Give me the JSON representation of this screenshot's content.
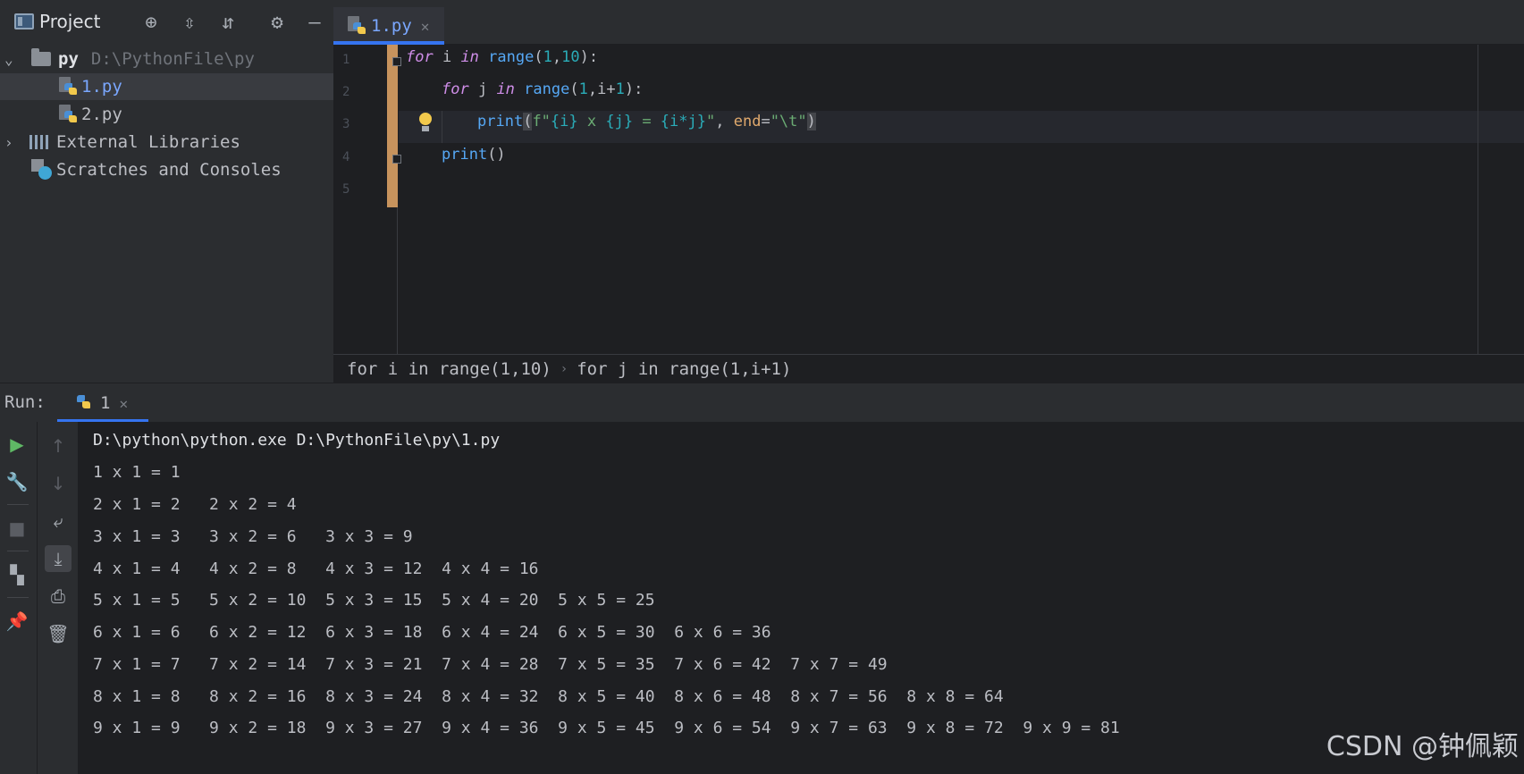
{
  "project": {
    "title": "Project",
    "tree": {
      "root_name": "py",
      "root_path": "D:\\PythonFile\\py",
      "files": [
        "1.py",
        "2.py"
      ],
      "external_libraries": "External Libraries",
      "scratches": "Scratches and Consoles"
    }
  },
  "editor": {
    "tab_label": "1.py",
    "line_numbers": [
      "1",
      "2",
      "3",
      "4",
      "5"
    ],
    "code": {
      "l1": {
        "kw1": "for",
        "v1": " i ",
        "kw2": "in",
        "sp": " ",
        "fn": "range",
        "p1": "(",
        "n1": "1",
        "c": ",",
        "n2": "10",
        "p2": ")",
        "end": ":"
      },
      "l2": {
        "kw1": "for",
        "v1": " j ",
        "kw2": "in",
        "sp": " ",
        "fn": "range",
        "p1": "(",
        "n1": "1",
        "c": ",",
        "v2": "i+",
        "n2": "1",
        "p2": ")",
        "end": ":"
      },
      "l3": {
        "fn": "print",
        "p1": "(",
        "s1": "f\"",
        "b1": "{i}",
        "s2": " x ",
        "b2": "{j}",
        "s3": " = ",
        "b3": "{i*j}",
        "s4": "\"",
        "c": ", ",
        "kw": "end",
        "eq": "=",
        "s5": "\"\\t\"",
        "p2": ")"
      },
      "l4": {
        "fn": "print",
        "p": "()"
      }
    },
    "breadcrumbs": [
      "for i in range(1,10)",
      "for j in range(1,i+1)"
    ],
    "breadcrumb_separator": "›"
  },
  "run": {
    "label": "Run:",
    "tab_label": "1",
    "command": "D:\\python\\python.exe D:\\PythonFile\\py\\1.py",
    "output": [
      "1 x 1 = 1",
      "2 x 1 = 2   2 x 2 = 4",
      "3 x 1 = 3   3 x 2 = 6   3 x 3 = 9",
      "4 x 1 = 4   4 x 2 = 8   4 x 3 = 12  4 x 4 = 16",
      "5 x 1 = 5   5 x 2 = 10  5 x 3 = 15  5 x 4 = 20  5 x 5 = 25",
      "6 x 1 = 6   6 x 2 = 12  6 x 3 = 18  6 x 4 = 24  6 x 5 = 30  6 x 6 = 36",
      "7 x 1 = 7   7 x 2 = 14  7 x 3 = 21  7 x 4 = 28  7 x 5 = 35  7 x 6 = 42  7 x 7 = 49",
      "8 x 1 = 8   8 x 2 = 16  8 x 3 = 24  8 x 4 = 32  8 x 5 = 40  8 x 6 = 48  8 x 7 = 56  8 x 8 = 64",
      "9 x 1 = 9   9 x 2 = 18  9 x 3 = 27  9 x 4 = 36  9 x 5 = 45  9 x 6 = 54  9 x 7 = 63  9 x 8 = 72  9 x 9 = 81"
    ]
  },
  "watermark": "CSDN @钟佩颖",
  "icons": {
    "project_toolbar": [
      "locate-icon",
      "expand-all-icon",
      "collapse-all-icon",
      "gear-icon",
      "minimize-icon"
    ],
    "run_left": [
      "run-icon",
      "wrench-icon",
      "stop-icon",
      "layout-icon",
      "pin-icon"
    ],
    "run_second": [
      "up-arrow-icon",
      "down-arrow-icon",
      "soft-wrap-icon",
      "scroll-to-end-icon",
      "print-icon",
      "trash-icon"
    ]
  },
  "colors": {
    "accent": "#3574f0",
    "keyword": "#cf8ee8",
    "function": "#56a8f5",
    "number": "#2aacb8",
    "string": "#6aab73",
    "change_marker": "#c7935d"
  }
}
